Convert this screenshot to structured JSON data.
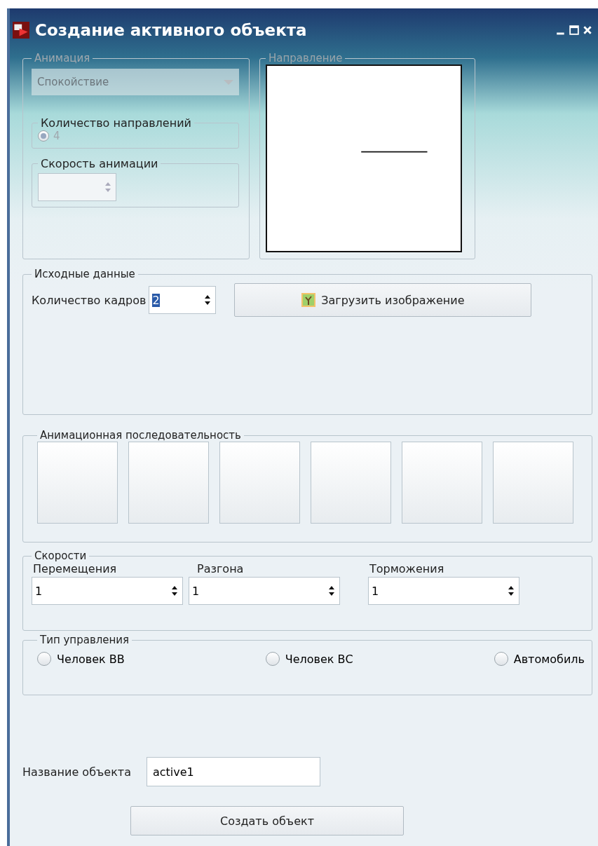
{
  "window": {
    "title": "Создание активного объекта"
  },
  "animation": {
    "title": "Анимация",
    "disabled": true,
    "dropdown": {
      "value": "Спокойствие"
    },
    "directions": {
      "title": "Количество направлений",
      "options": [
        {
          "label": "4",
          "selected": true
        }
      ]
    },
    "speed": {
      "title": "Скорость анимации"
    }
  },
  "direction": {
    "title": "Направление"
  },
  "source": {
    "title": "Исходные данные",
    "frames_label": "Количество кадров",
    "frames_value": "2",
    "frames_value_selected": true,
    "load_button": "Загрузить изображение"
  },
  "sequence": {
    "title": "Анимационная последовательность",
    "frames": [
      {
        "kind": "empty"
      },
      {
        "kind": "empty"
      },
      {
        "kind": "empty"
      },
      {
        "kind": "empty"
      },
      {
        "kind": "empty"
      },
      {
        "kind": "empty"
      }
    ]
  },
  "speeds": {
    "title": "Скорости",
    "fields": [
      {
        "label": "Перемещения",
        "value": "1"
      },
      {
        "label": "Разгона",
        "value": "1"
      },
      {
        "label": "Торможения",
        "value": "1"
      }
    ]
  },
  "control_type": {
    "title": "Тип управления",
    "options": [
      {
        "label": "Человек ВВ",
        "selected": false
      },
      {
        "label": "Человек ВС",
        "selected": false
      },
      {
        "label": "Автомобиль",
        "selected": false
      }
    ]
  },
  "object_name": {
    "label": "Название объекта",
    "value": "active1"
  },
  "create_button": "Создать объект"
}
